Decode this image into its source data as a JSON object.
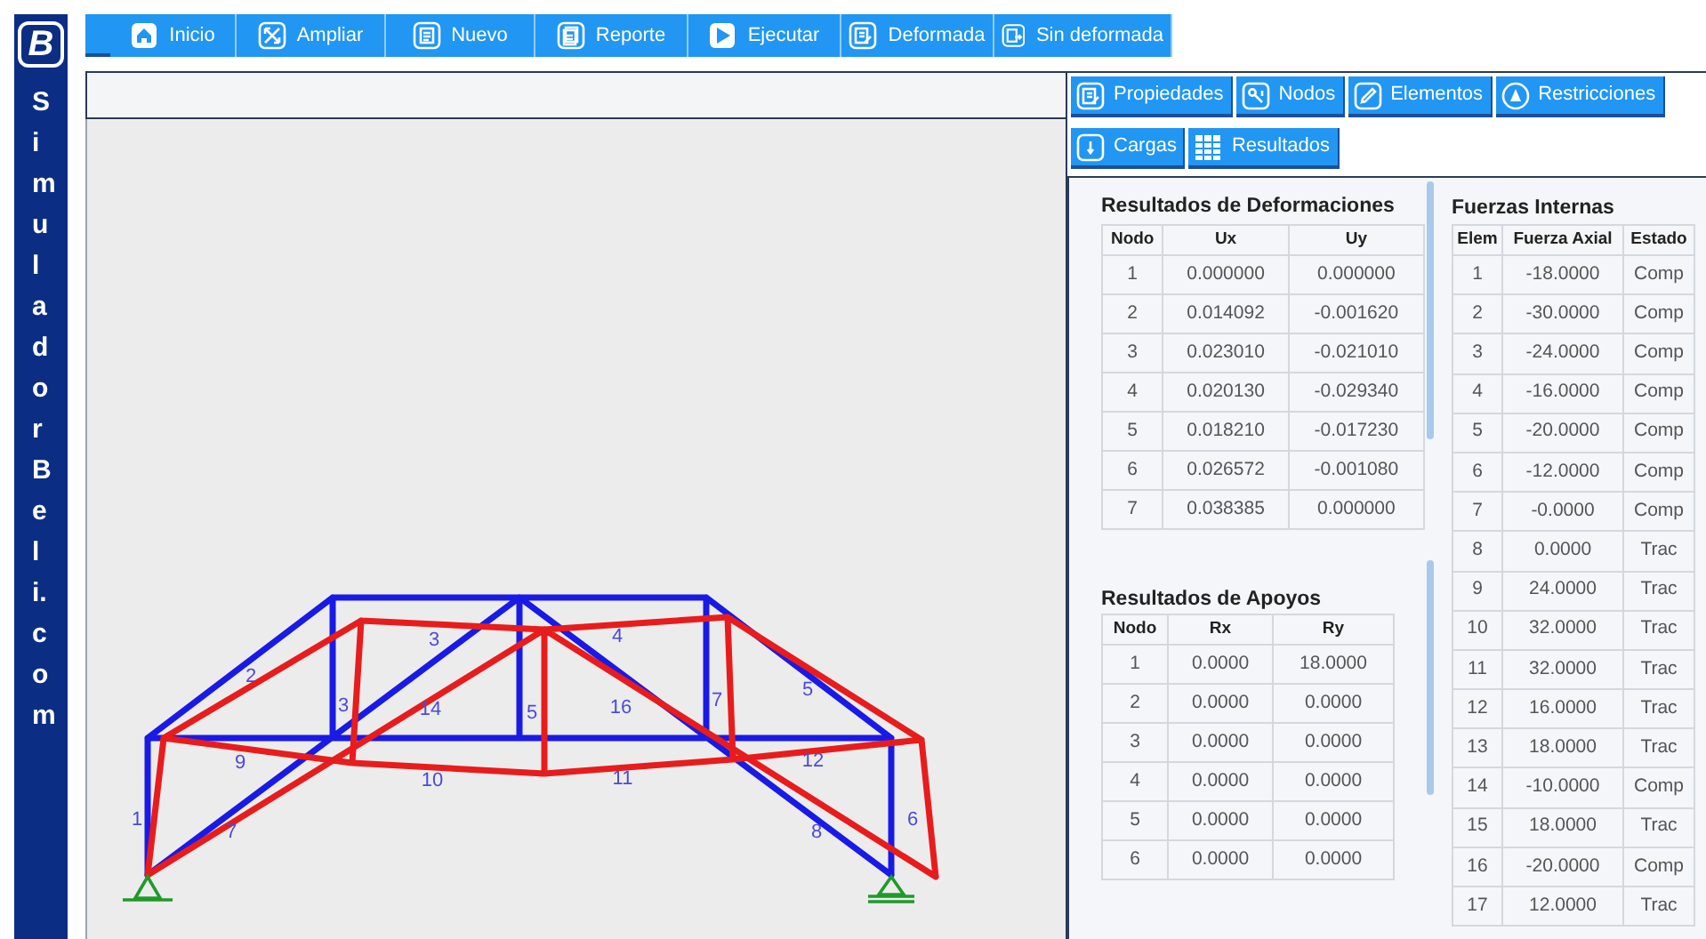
{
  "sidebar": {
    "logo": "B",
    "brand": "SimuladorBeli.com"
  },
  "toolbar": [
    {
      "label": "Inicio"
    },
    {
      "label": "Ampliar"
    },
    {
      "label": "Nuevo"
    },
    {
      "label": "Reporte"
    },
    {
      "label": "Ejecutar"
    },
    {
      "label": "Deformada"
    },
    {
      "label": "Sin deformada"
    }
  ],
  "panel_tabs": [
    [
      {
        "label": "Propiedades"
      },
      {
        "label": "Nodos"
      },
      {
        "label": "Elementos"
      },
      {
        "label": "Restricciones"
      }
    ],
    [
      {
        "label": "Cargas"
      },
      {
        "label": "Resultados"
      }
    ]
  ],
  "truss": {
    "member_labels": [
      "1",
      "2",
      "3",
      "3",
      "14",
      "5",
      "16",
      "7",
      "4",
      "5",
      "9",
      "10",
      "11",
      "12",
      "7",
      "8",
      "6"
    ]
  },
  "deformations": {
    "title": "Resultados de Deformaciones",
    "columns": [
      "Nodo",
      "Ux",
      "Uy"
    ],
    "rows": [
      [
        "1",
        "0.000000",
        "0.000000"
      ],
      [
        "2",
        "0.014092",
        "-0.001620"
      ],
      [
        "3",
        "0.023010",
        "-0.021010"
      ],
      [
        "4",
        "0.020130",
        "-0.029340"
      ],
      [
        "5",
        "0.018210",
        "-0.017230"
      ],
      [
        "6",
        "0.026572",
        "-0.001080"
      ],
      [
        "7",
        "0.038385",
        "0.000000"
      ]
    ]
  },
  "supports": {
    "title": "Resultados de Apoyos",
    "columns": [
      "Nodo",
      "Rx",
      "Ry"
    ],
    "rows": [
      [
        "1",
        "0.0000",
        "18.0000"
      ],
      [
        "2",
        "0.0000",
        "0.0000"
      ],
      [
        "3",
        "0.0000",
        "0.0000"
      ],
      [
        "4",
        "0.0000",
        "0.0000"
      ],
      [
        "5",
        "0.0000",
        "0.0000"
      ],
      [
        "6",
        "0.0000",
        "0.0000"
      ]
    ]
  },
  "internal_forces": {
    "title": "Fuerzas Internas",
    "columns": [
      "Elem",
      "Fuerza Axial",
      "Estado"
    ],
    "rows": [
      [
        "1",
        "-18.0000",
        "Comp"
      ],
      [
        "2",
        "-30.0000",
        "Comp"
      ],
      [
        "3",
        "-24.0000",
        "Comp"
      ],
      [
        "4",
        "-16.0000",
        "Comp"
      ],
      [
        "5",
        "-20.0000",
        "Comp"
      ],
      [
        "6",
        "-12.0000",
        "Comp"
      ],
      [
        "7",
        "-0.0000",
        "Comp"
      ],
      [
        "8",
        "0.0000",
        "Trac"
      ],
      [
        "9",
        "24.0000",
        "Trac"
      ],
      [
        "10",
        "32.0000",
        "Trac"
      ],
      [
        "11",
        "32.0000",
        "Trac"
      ],
      [
        "12",
        "16.0000",
        "Trac"
      ],
      [
        "13",
        "18.0000",
        "Trac"
      ],
      [
        "14",
        "-10.0000",
        "Comp"
      ],
      [
        "15",
        "18.0000",
        "Trac"
      ],
      [
        "16",
        "-20.0000",
        "Comp"
      ],
      [
        "17",
        "12.0000",
        "Trac"
      ]
    ]
  }
}
